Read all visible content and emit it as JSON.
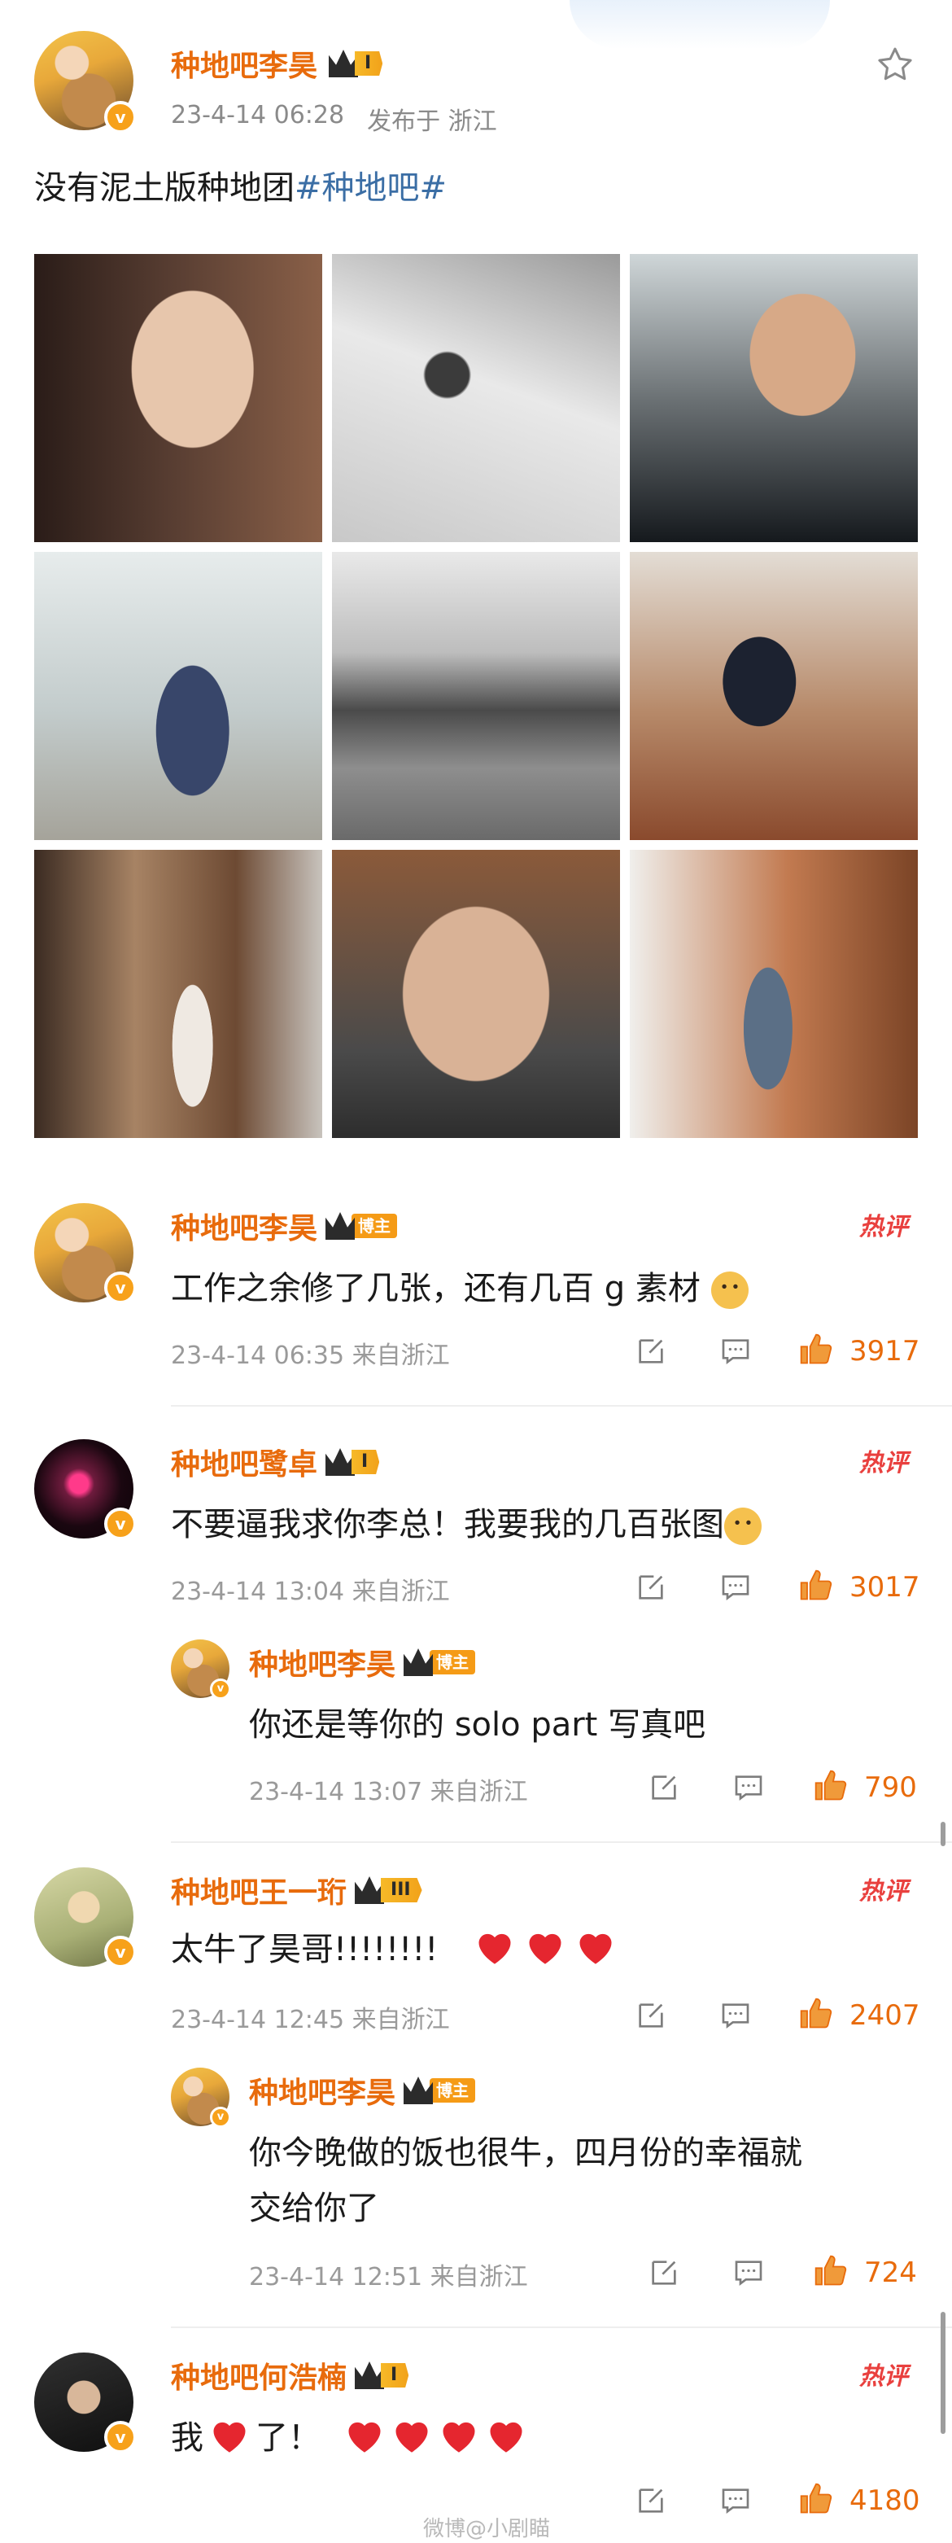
{
  "post": {
    "author": "种地吧李昊",
    "level": "I",
    "time": "23-4-14 06:28",
    "location": "发布于 浙江",
    "text": "没有泥土版种地团",
    "hashtag": "#种地吧#"
  },
  "comments": [
    {
      "author": "种地吧李昊",
      "badge": "博主",
      "text": "工作之余修了几张，还有几百 g 素材",
      "time_location": "23-4-14 06:35  来自浙江",
      "likes": "3917",
      "hot": "热评"
    },
    {
      "author": "种地吧鹭卓",
      "level": "I",
      "text": "不要逼我求你李总！我要我的几百张图",
      "time_location": "23-4-14 13:04  来自浙江",
      "likes": "3017",
      "hot": "热评",
      "reply": {
        "author": "种地吧李昊",
        "badge": "博主",
        "text": "你还是等你的 solo part 写真吧",
        "time_location": "23-4-14 13:07  来自浙江",
        "likes": "790"
      }
    },
    {
      "author": "种地吧王一珩",
      "level": "III",
      "text": "太牛了昊哥!!!!!!!!",
      "time_location": "23-4-14 12:45  来自浙江",
      "likes": "2407",
      "hot": "热评",
      "reply": {
        "author": "种地吧李昊",
        "badge": "博主",
        "text_line1": "你今晚做的饭也很牛，四月份的幸福就",
        "text_line2": "交给你了",
        "time_location": "23-4-14 12:51  来自浙江",
        "likes": "724"
      }
    },
    {
      "author": "种地吧何浩楠",
      "level": "I",
      "text_a": "我",
      "text_b": "了！",
      "time_location": "",
      "likes": "4180",
      "hot": "热评"
    }
  ],
  "watermark": "微博@小剧瞄",
  "colors": {
    "accent": "#e86b0c",
    "link": "#3b6ea5",
    "hot": "#e9403e",
    "heart": "#e5262f"
  }
}
